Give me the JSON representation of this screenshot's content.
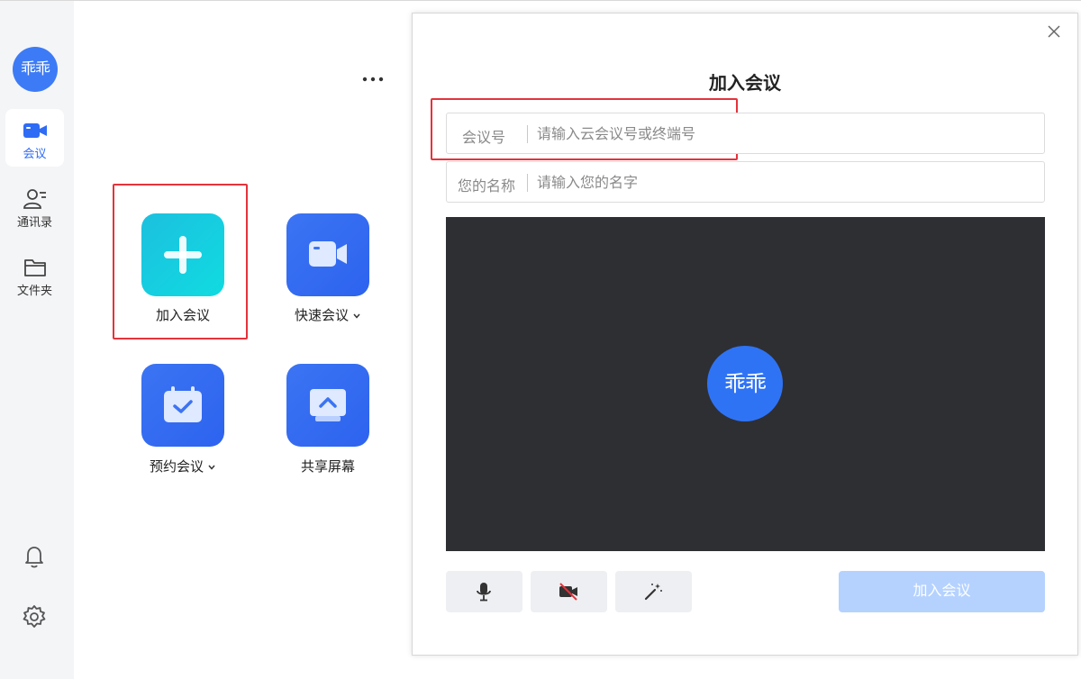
{
  "user": {
    "avatar_text": "乖乖"
  },
  "sidebar": {
    "items": [
      {
        "label": "会议",
        "icon": "video-camera-icon",
        "active": true
      },
      {
        "label": "通讯录",
        "icon": "contacts-icon",
        "active": false
      },
      {
        "label": "文件夹",
        "icon": "folder-icon",
        "active": false
      }
    ],
    "bottom_icons": [
      "bell-icon",
      "gear-icon"
    ]
  },
  "main": {
    "more_icon": "more-horizontal-icon",
    "tiles": [
      {
        "label": "加入会议",
        "icon": "plus-icon",
        "has_dropdown": false
      },
      {
        "label": "快速会议",
        "icon": "video-camera-icon",
        "has_dropdown": true
      },
      {
        "label": "预约会议",
        "icon": "calendar-check-icon",
        "has_dropdown": true
      },
      {
        "label": "共享屏幕",
        "icon": "screen-share-icon",
        "has_dropdown": false
      }
    ]
  },
  "dialog": {
    "title": "加入会议",
    "meeting_id": {
      "label": "会议号",
      "placeholder": "请输入云会议号或终端号",
      "value": ""
    },
    "name": {
      "label": "您的名称",
      "placeholder": "请输入您的名字",
      "value": ""
    },
    "preview_avatar_text": "乖乖",
    "controls": [
      "microphone-icon",
      "camera-off-icon",
      "magic-wand-icon"
    ],
    "join_button_label": "加入会议"
  },
  "colors": {
    "accent": "#2f6cf5",
    "highlight_border": "#e4333b",
    "preview_bg": "#2e2f33",
    "join_disabled": "#b5d2ff",
    "tile_green": "#10d0e0",
    "tile_blue": "#3168f2"
  }
}
